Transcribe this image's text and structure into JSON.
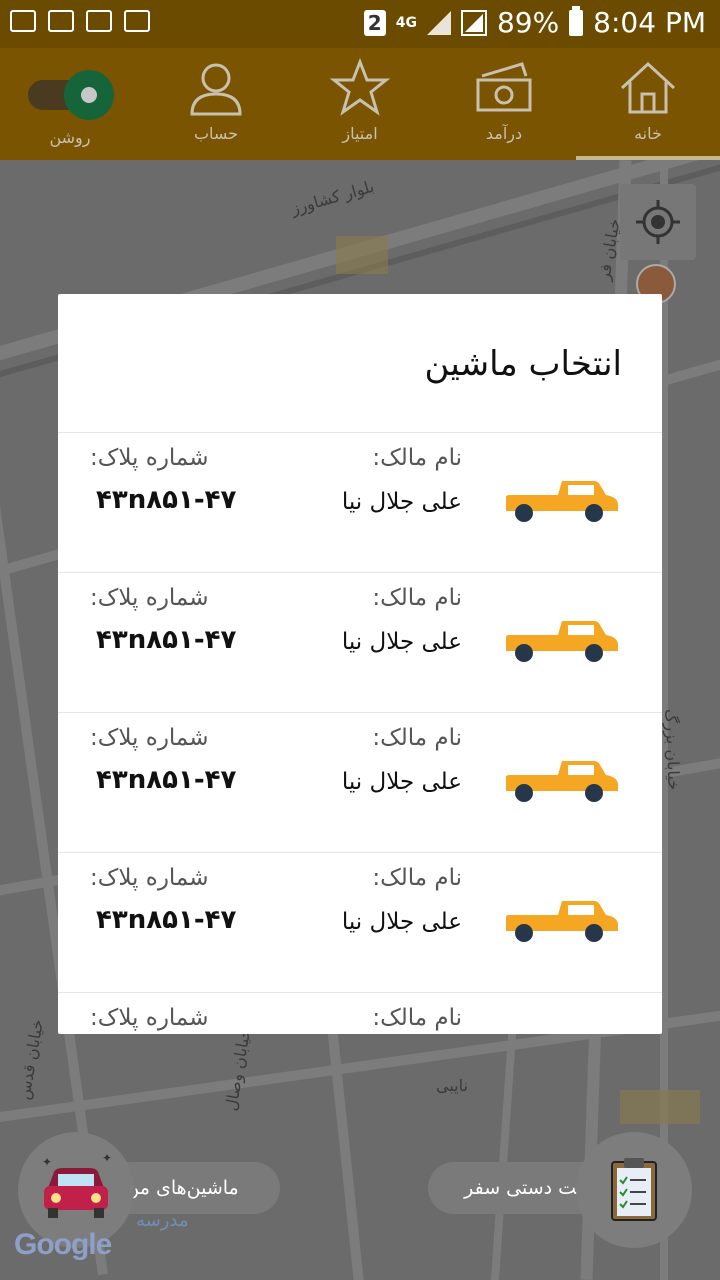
{
  "status_bar": {
    "badge": "2",
    "network": "4G",
    "battery": "89%",
    "time": "8:04 PM"
  },
  "nav": {
    "toggle_label": "روشن",
    "items": [
      {
        "label": "حساب",
        "icon": "person-icon"
      },
      {
        "label": "امتیاز",
        "icon": "star-icon"
      },
      {
        "label": "درآمد",
        "icon": "money-icon"
      },
      {
        "label": "خانه",
        "icon": "home-icon"
      }
    ],
    "active": "خانه"
  },
  "map": {
    "labels": [
      "بلوار کشاورز",
      "خیابان فر",
      "خیابان بزرگ",
      "نایبی",
      "خیابان قدس",
      "خیابان وصال"
    ]
  },
  "dialog": {
    "title": "انتخاب ماشین",
    "owner_label": "نام مالک:",
    "plate_label": "شماره پلاک:",
    "cars": [
      {
        "owner": "علی جلال نیا",
        "plate": "۴۳n۸۵۱-۴۷"
      },
      {
        "owner": "علی جلال نیا",
        "plate": "۴۳n۸۵۱-۴۷"
      },
      {
        "owner": "علی جلال نیا",
        "plate": "۴۳n۸۵۱-۴۷"
      },
      {
        "owner": "علی جلال نیا",
        "plate": "۴۳n۸۵۱-۴۷"
      },
      {
        "owner": "",
        "plate": ""
      }
    ]
  },
  "bottom": {
    "my_cars_label": "ماشین‌های من",
    "manual_trip_label": "ثبت دستی سفر",
    "google": "Google",
    "school": "مدرسه"
  },
  "colors": {
    "accent": "#7a5400",
    "car": "#f5a623",
    "toggle_knob": "#16643a"
  }
}
